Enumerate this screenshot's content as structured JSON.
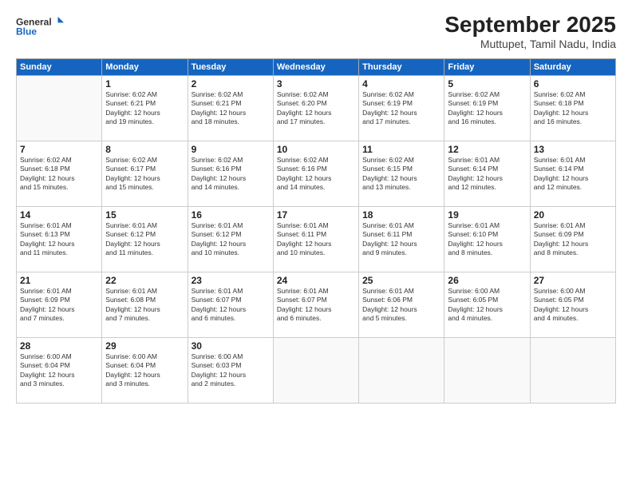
{
  "header": {
    "logo_line1": "General",
    "logo_line2": "Blue",
    "title": "September 2025",
    "subtitle": "Muttupet, Tamil Nadu, India"
  },
  "days_header": [
    "Sunday",
    "Monday",
    "Tuesday",
    "Wednesday",
    "Thursday",
    "Friday",
    "Saturday"
  ],
  "weeks": [
    [
      {
        "day": "",
        "info": ""
      },
      {
        "day": "1",
        "info": "Sunrise: 6:02 AM\nSunset: 6:21 PM\nDaylight: 12 hours\nand 19 minutes."
      },
      {
        "day": "2",
        "info": "Sunrise: 6:02 AM\nSunset: 6:21 PM\nDaylight: 12 hours\nand 18 minutes."
      },
      {
        "day": "3",
        "info": "Sunrise: 6:02 AM\nSunset: 6:20 PM\nDaylight: 12 hours\nand 17 minutes."
      },
      {
        "day": "4",
        "info": "Sunrise: 6:02 AM\nSunset: 6:19 PM\nDaylight: 12 hours\nand 17 minutes."
      },
      {
        "day": "5",
        "info": "Sunrise: 6:02 AM\nSunset: 6:19 PM\nDaylight: 12 hours\nand 16 minutes."
      },
      {
        "day": "6",
        "info": "Sunrise: 6:02 AM\nSunset: 6:18 PM\nDaylight: 12 hours\nand 16 minutes."
      }
    ],
    [
      {
        "day": "7",
        "info": "Sunrise: 6:02 AM\nSunset: 6:18 PM\nDaylight: 12 hours\nand 15 minutes."
      },
      {
        "day": "8",
        "info": "Sunrise: 6:02 AM\nSunset: 6:17 PM\nDaylight: 12 hours\nand 15 minutes."
      },
      {
        "day": "9",
        "info": "Sunrise: 6:02 AM\nSunset: 6:16 PM\nDaylight: 12 hours\nand 14 minutes."
      },
      {
        "day": "10",
        "info": "Sunrise: 6:02 AM\nSunset: 6:16 PM\nDaylight: 12 hours\nand 14 minutes."
      },
      {
        "day": "11",
        "info": "Sunrise: 6:02 AM\nSunset: 6:15 PM\nDaylight: 12 hours\nand 13 minutes."
      },
      {
        "day": "12",
        "info": "Sunrise: 6:01 AM\nSunset: 6:14 PM\nDaylight: 12 hours\nand 12 minutes."
      },
      {
        "day": "13",
        "info": "Sunrise: 6:01 AM\nSunset: 6:14 PM\nDaylight: 12 hours\nand 12 minutes."
      }
    ],
    [
      {
        "day": "14",
        "info": "Sunrise: 6:01 AM\nSunset: 6:13 PM\nDaylight: 12 hours\nand 11 minutes."
      },
      {
        "day": "15",
        "info": "Sunrise: 6:01 AM\nSunset: 6:12 PM\nDaylight: 12 hours\nand 11 minutes."
      },
      {
        "day": "16",
        "info": "Sunrise: 6:01 AM\nSunset: 6:12 PM\nDaylight: 12 hours\nand 10 minutes."
      },
      {
        "day": "17",
        "info": "Sunrise: 6:01 AM\nSunset: 6:11 PM\nDaylight: 12 hours\nand 10 minutes."
      },
      {
        "day": "18",
        "info": "Sunrise: 6:01 AM\nSunset: 6:11 PM\nDaylight: 12 hours\nand 9 minutes."
      },
      {
        "day": "19",
        "info": "Sunrise: 6:01 AM\nSunset: 6:10 PM\nDaylight: 12 hours\nand 8 minutes."
      },
      {
        "day": "20",
        "info": "Sunrise: 6:01 AM\nSunset: 6:09 PM\nDaylight: 12 hours\nand 8 minutes."
      }
    ],
    [
      {
        "day": "21",
        "info": "Sunrise: 6:01 AM\nSunset: 6:09 PM\nDaylight: 12 hours\nand 7 minutes."
      },
      {
        "day": "22",
        "info": "Sunrise: 6:01 AM\nSunset: 6:08 PM\nDaylight: 12 hours\nand 7 minutes."
      },
      {
        "day": "23",
        "info": "Sunrise: 6:01 AM\nSunset: 6:07 PM\nDaylight: 12 hours\nand 6 minutes."
      },
      {
        "day": "24",
        "info": "Sunrise: 6:01 AM\nSunset: 6:07 PM\nDaylight: 12 hours\nand 6 minutes."
      },
      {
        "day": "25",
        "info": "Sunrise: 6:01 AM\nSunset: 6:06 PM\nDaylight: 12 hours\nand 5 minutes."
      },
      {
        "day": "26",
        "info": "Sunrise: 6:00 AM\nSunset: 6:05 PM\nDaylight: 12 hours\nand 4 minutes."
      },
      {
        "day": "27",
        "info": "Sunrise: 6:00 AM\nSunset: 6:05 PM\nDaylight: 12 hours\nand 4 minutes."
      }
    ],
    [
      {
        "day": "28",
        "info": "Sunrise: 6:00 AM\nSunset: 6:04 PM\nDaylight: 12 hours\nand 3 minutes."
      },
      {
        "day": "29",
        "info": "Sunrise: 6:00 AM\nSunset: 6:04 PM\nDaylight: 12 hours\nand 3 minutes."
      },
      {
        "day": "30",
        "info": "Sunrise: 6:00 AM\nSunset: 6:03 PM\nDaylight: 12 hours\nand 2 minutes."
      },
      {
        "day": "",
        "info": ""
      },
      {
        "day": "",
        "info": ""
      },
      {
        "day": "",
        "info": ""
      },
      {
        "day": "",
        "info": ""
      }
    ]
  ]
}
